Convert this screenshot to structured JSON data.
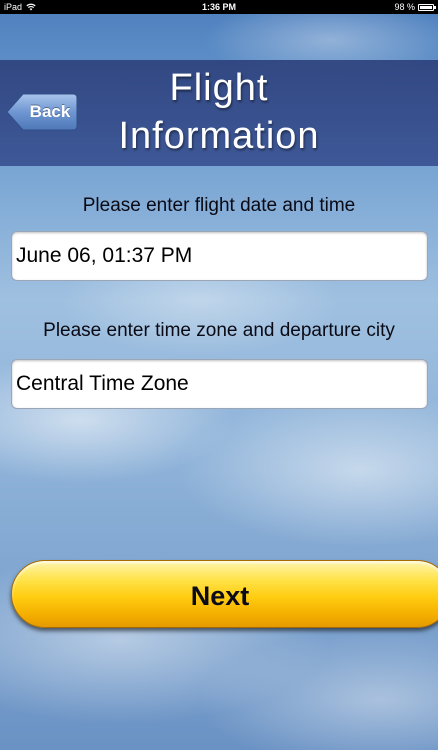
{
  "status_bar": {
    "device": "iPad",
    "time": "1:36 PM",
    "battery_percent": "98 %",
    "battery_level": 0.98
  },
  "header": {
    "back_label": "Back",
    "title": "Flight\nInformation"
  },
  "form": {
    "date_label": "Please enter flight date and time",
    "date_value": "June 06, 01:37 PM",
    "timezone_label": "Please enter time zone and  departure city",
    "timezone_value": "Central Time Zone"
  },
  "actions": {
    "next_label": "Next"
  },
  "icons": {
    "wifi": "wifi-icon",
    "battery": "battery-icon"
  }
}
